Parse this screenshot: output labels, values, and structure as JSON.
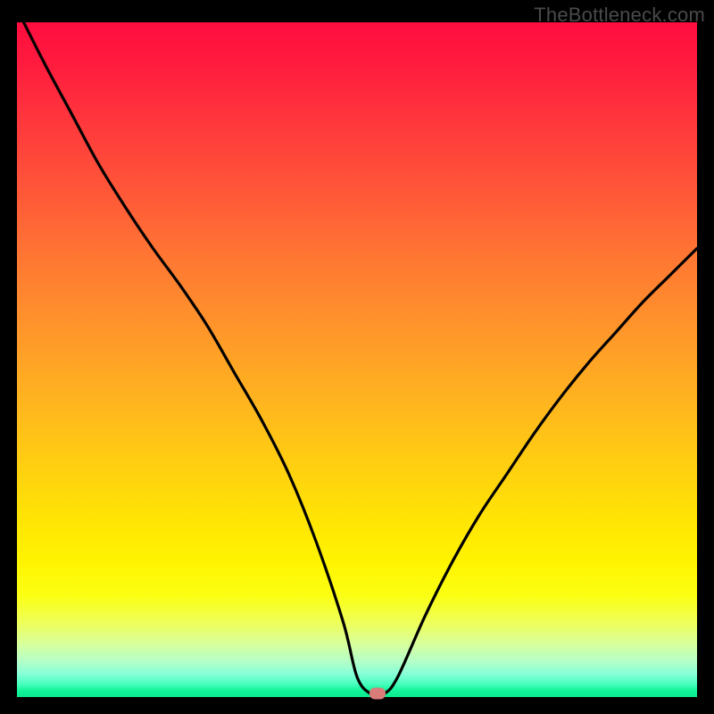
{
  "watermark": "TheBottleneck.com",
  "chart_data": {
    "type": "line",
    "title": "",
    "xlabel": "",
    "ylabel": "",
    "xlim": [
      0,
      100
    ],
    "ylim": [
      0,
      100
    ],
    "x": [
      0,
      4,
      8,
      12,
      16,
      20,
      24,
      28,
      32,
      36,
      40,
      44,
      48,
      50,
      52,
      54,
      56,
      60,
      64,
      68,
      72,
      76,
      80,
      84,
      88,
      92,
      96,
      100
    ],
    "y": [
      102,
      94,
      86.5,
      79,
      72.5,
      66.5,
      61,
      55,
      48,
      41,
      33,
      23,
      11,
      3,
      0.5,
      0.5,
      3,
      12,
      20,
      27,
      33,
      39,
      44.5,
      49.5,
      54,
      58.5,
      62.5,
      66.5
    ],
    "marker": {
      "x": 53,
      "y": 0.5
    },
    "background": {
      "type": "vertical-gradient",
      "stops": [
        {
          "pct": 0,
          "color": "#ff0d3f"
        },
        {
          "pct": 50,
          "color": "#ffb41f"
        },
        {
          "pct": 80,
          "color": "#fff400"
        },
        {
          "pct": 100,
          "color": "#0ae98e"
        }
      ]
    }
  }
}
